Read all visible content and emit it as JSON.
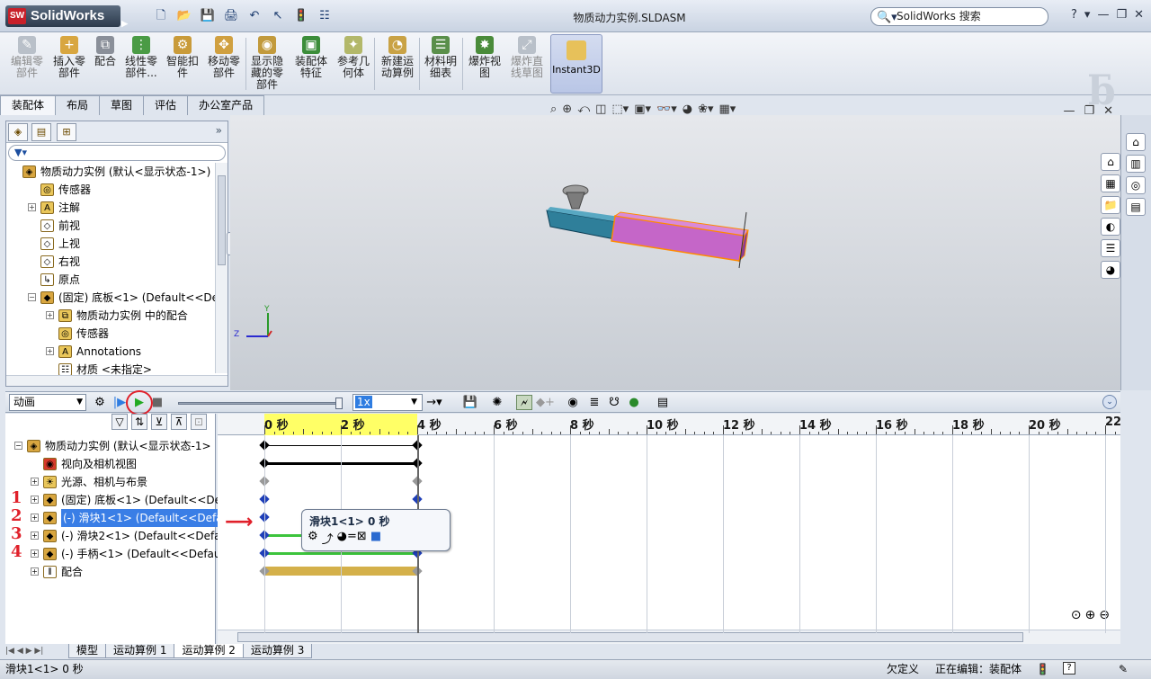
{
  "app": {
    "logo_text": "SolidWorks",
    "logo_badge": "SW",
    "document_title": "物质动力实例.SLDASM",
    "search_placeholder": "SolidWorks 搜索",
    "help": "?"
  },
  "ribbon": {
    "buttons": [
      {
        "label": "编辑零部件",
        "icon": "edit-component-icon",
        "disabled": true
      },
      {
        "label": "插入零部件",
        "icon": "insert-components-icon"
      },
      {
        "label": "配合",
        "icon": "mate-icon"
      },
      {
        "label": "线性零部件...",
        "icon": "linear-pattern-icon"
      },
      {
        "label": "智能扣件",
        "icon": "smart-fasteners-icon"
      },
      {
        "label": "移动零部件",
        "icon": "move-component-icon"
      },
      {
        "label": "显示隐藏的零部件",
        "icon": "show-hidden-icon"
      },
      {
        "label": "装配体特征",
        "icon": "assembly-features-icon"
      },
      {
        "label": "参考几何体",
        "icon": "reference-geometry-icon"
      },
      {
        "label": "新建运动算例",
        "icon": "new-motion-study-icon"
      },
      {
        "label": "材料明细表",
        "icon": "bom-icon"
      },
      {
        "label": "爆炸视图",
        "icon": "exploded-view-icon"
      },
      {
        "label": "爆炸直线草图",
        "icon": "explode-line-sketch-icon",
        "disabled": true
      }
    ],
    "instant3d": "Instant3D"
  },
  "command_tabs": [
    "装配体",
    "布局",
    "草图",
    "评估",
    "办公室产品"
  ],
  "feature_tree": [
    {
      "label": "物质动力实例  (默认<显示状态-1>)",
      "icon": "assembly-icon",
      "indent": 0,
      "expand": ""
    },
    {
      "label": "传感器",
      "icon": "sensor-icon",
      "indent": 1,
      "expand": ""
    },
    {
      "label": "注解",
      "icon": "annotation-icon",
      "indent": 1,
      "expand": "+"
    },
    {
      "label": "前视",
      "icon": "plane-icon",
      "indent": 1,
      "expand": ""
    },
    {
      "label": "上视",
      "icon": "plane-icon",
      "indent": 1,
      "expand": ""
    },
    {
      "label": "右视",
      "icon": "plane-icon",
      "indent": 1,
      "expand": ""
    },
    {
      "label": "原点",
      "icon": "origin-icon",
      "indent": 1,
      "expand": ""
    },
    {
      "label": "(固定) 底板<1> (Default<<Default",
      "icon": "part-icon",
      "indent": 1,
      "expand": "−"
    },
    {
      "label": "物质动力实例 中的配合",
      "icon": "mate-folder-icon",
      "indent": 2,
      "expand": "+"
    },
    {
      "label": "传感器",
      "icon": "sensor-icon",
      "indent": 2,
      "expand": ""
    },
    {
      "label": "Annotations",
      "icon": "annotation-icon",
      "indent": 2,
      "expand": "+"
    },
    {
      "label": "材质 <未指定>",
      "icon": "material-icon",
      "indent": 2,
      "expand": ""
    }
  ],
  "motion": {
    "study_type": "动画",
    "speed": "1x",
    "timeline_end": 4,
    "tree": [
      {
        "label": "物质动力实例  (默认<显示状态-1>",
        "icon": "assembly-icon",
        "indent": 0,
        "expand": "−",
        "mark": ""
      },
      {
        "label": "视向及相机视图",
        "icon": "camera-icon",
        "indent": 1,
        "expand": "",
        "mark": ""
      },
      {
        "label": "光源、相机与布景",
        "icon": "lights-icon",
        "indent": 1,
        "expand": "+",
        "mark": ""
      },
      {
        "label": "(固定) 底板<1> (Default<<De",
        "icon": "part-icon",
        "indent": 1,
        "expand": "+",
        "mark": "1"
      },
      {
        "label": "(-) 滑块1<1> (Default<<Defa",
        "icon": "part-icon",
        "indent": 1,
        "expand": "+",
        "mark": "2",
        "selected": true
      },
      {
        "label": "(-) 滑块2<1> (Default<<Defa",
        "icon": "part-icon",
        "indent": 1,
        "expand": "+",
        "mark": "3"
      },
      {
        "label": "(-) 手柄<1> (Default<<Defau",
        "icon": "part-icon",
        "indent": 1,
        "expand": "+",
        "mark": "4"
      },
      {
        "label": "配合",
        "icon": "mates-icon",
        "indent": 1,
        "expand": "+",
        "mark": ""
      }
    ],
    "ticks": [
      "0 秒",
      "2 秒",
      "4 秒",
      "6 秒",
      "8 秒",
      "10 秒",
      "12 秒",
      "14 秒",
      "16 秒",
      "18 秒",
      "20 秒",
      "22"
    ],
    "tooltip": "滑块1<1> 0 秒"
  },
  "bottom_tabs": [
    "模型",
    "运动算例 1",
    "运动算例 2",
    "运动算例 3"
  ],
  "active_bottom_tab": 2,
  "status": {
    "left": "滑块1<1> 0 秒",
    "underdefined": "欠定义",
    "editing": "正在编辑：装配体"
  },
  "colors": {
    "selection_blue": "#3a7ee6",
    "timeline_highlight": "#ffff66",
    "key_blue": "#1f3fb8",
    "track_green": "#3cc43c",
    "track_gold": "#d4b04a",
    "annotation_red": "#e0202a"
  }
}
